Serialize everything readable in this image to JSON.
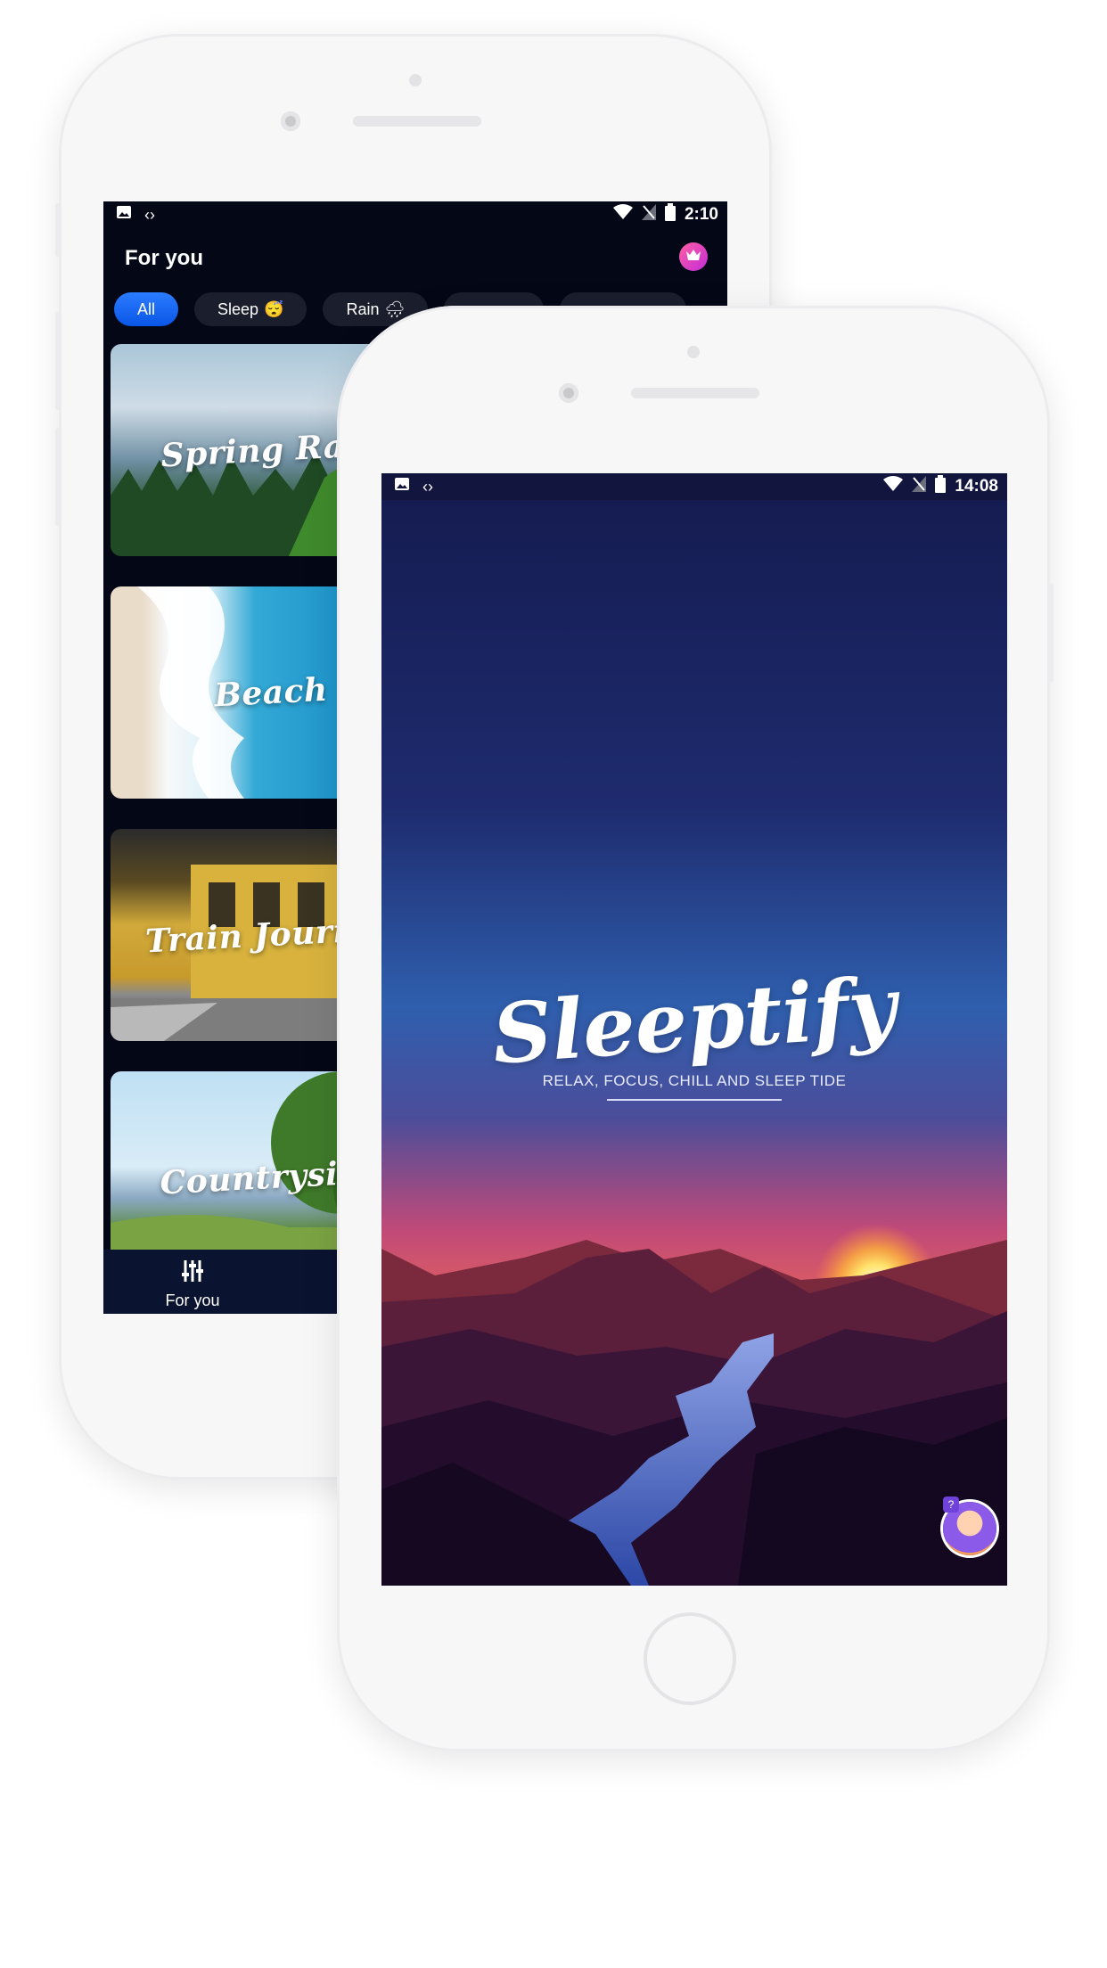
{
  "back_phone": {
    "status_bar": {
      "time": "2:10",
      "icons": [
        "image-icon",
        "code-icon",
        "wifi-icon",
        "no-signal-icon",
        "battery-icon"
      ]
    },
    "header": {
      "title": "For you",
      "premium_icon": "crown-icon"
    },
    "filters": [
      {
        "label": "All",
        "active": true,
        "emoji": ""
      },
      {
        "label": "Sleep",
        "active": false,
        "emoji": "😴"
      },
      {
        "label": "Rain",
        "active": false,
        "emoji": "🌧"
      },
      {
        "label": "",
        "active": false,
        "emoji": ""
      },
      {
        "label": "",
        "active": false,
        "emoji": ""
      }
    ],
    "cards": [
      {
        "title": "Spring Rain"
      },
      {
        "title": "Beach"
      },
      {
        "title": "Train Journey"
      },
      {
        "title": "Countryside"
      }
    ],
    "bottom_nav": [
      {
        "label": "For you",
        "icon": "sliders-icon"
      }
    ]
  },
  "front_phone": {
    "status_bar": {
      "time": "14:08",
      "icons": [
        "image-icon",
        "code-icon",
        "wifi-icon",
        "no-signal-icon",
        "battery-icon"
      ]
    },
    "app_name": "Sleeptify",
    "tagline": "RELAX, FOCUS, CHILL AND SLEEP TIDE",
    "assistant_icon": "avatar-girl-icon",
    "assistant_badge": "?"
  },
  "colors": {
    "accent": "#0a56e6",
    "back_bg": "#040716",
    "nav_bg": "#0a1330",
    "premium": "#c22bd8"
  }
}
